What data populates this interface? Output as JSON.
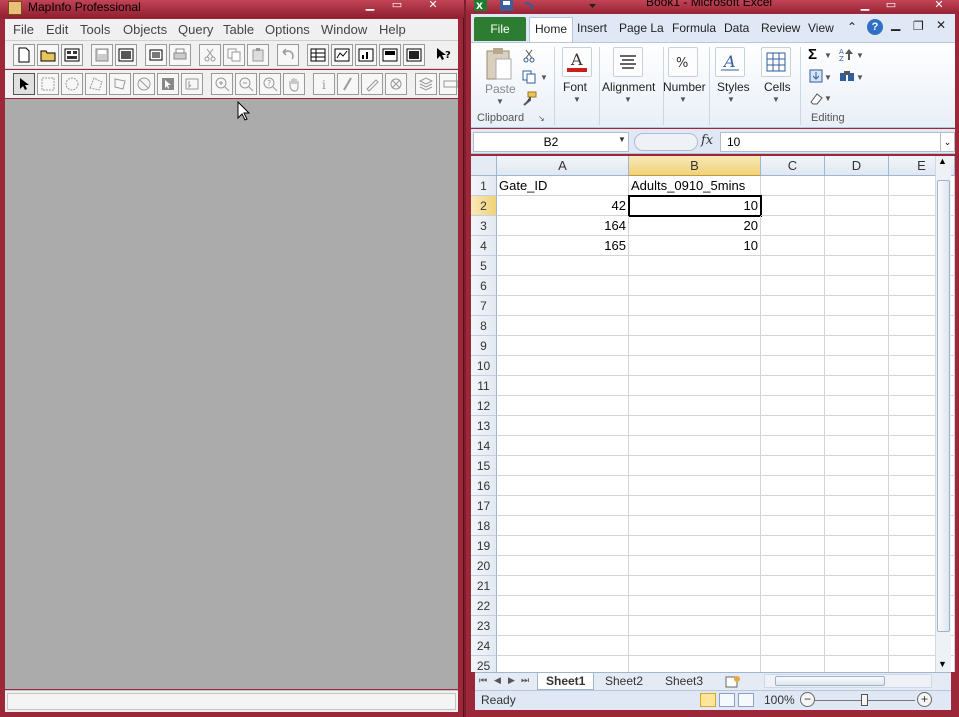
{
  "mapinfo": {
    "title": "MapInfo Professional",
    "menu": [
      "File",
      "Edit",
      "Tools",
      "Objects",
      "Query",
      "Table",
      "Options",
      "Window",
      "Help"
    ]
  },
  "excel": {
    "title": "Book1 - Microsoft Excel",
    "tabs": {
      "file": "File",
      "home": "Home",
      "insert": "Insert",
      "page_layout": "Page La",
      "formulas": "Formula",
      "data": "Data",
      "review": "Review",
      "view": "View"
    },
    "ribbon": {
      "paste": "Paste",
      "clipboard": "Clipboard",
      "font": "Font",
      "alignment": "Alignment",
      "number": "Number",
      "styles": "Styles",
      "cells": "Cells",
      "editing": "Editing"
    },
    "formula_bar": {
      "name_box": "B2",
      "fx": "fx",
      "value": "10"
    },
    "columns": [
      "A",
      "B",
      "C",
      "D",
      "E"
    ],
    "rows": [
      "1",
      "2",
      "3",
      "4",
      "5",
      "6",
      "7",
      "8",
      "9",
      "10",
      "11",
      "12",
      "13",
      "14",
      "15",
      "16",
      "17",
      "18",
      "19",
      "20",
      "21",
      "22",
      "23",
      "24",
      "25"
    ],
    "cells": {
      "A1": "Gate_ID",
      "B1": "Adults_0910_5mins",
      "A2": "42",
      "B2": "10",
      "A3": "164",
      "B3": "20",
      "A4": "165",
      "B4": "10"
    },
    "sheets": [
      "Sheet1",
      "Sheet2",
      "Sheet3"
    ],
    "status": {
      "ready": "Ready",
      "zoom": "100%"
    }
  }
}
